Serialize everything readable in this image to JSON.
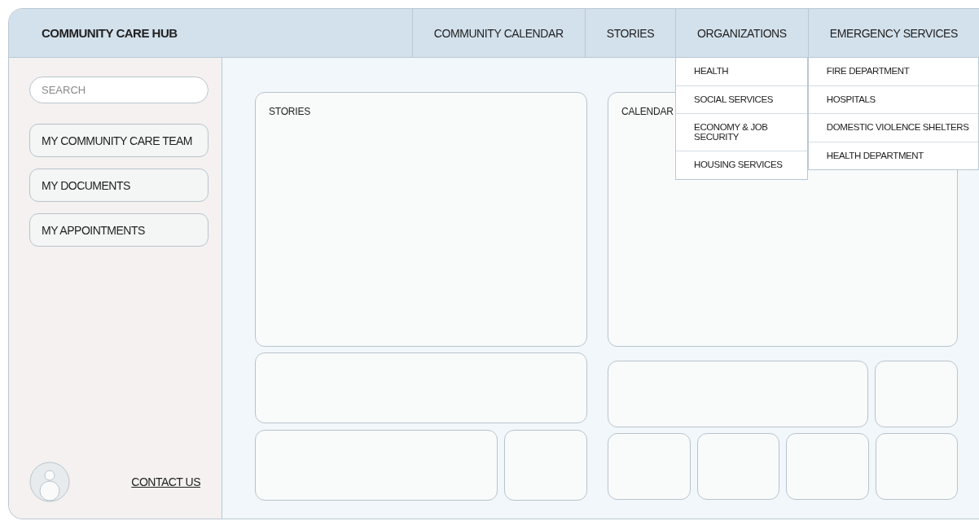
{
  "header": {
    "title": "COMMUNITY CARE HUB"
  },
  "nav": [
    {
      "label": "COMMUNITY CALENDAR"
    },
    {
      "label": "STORIES"
    },
    {
      "label": "ORGANIZATIONS",
      "menu": [
        "HEALTH",
        "SOCIAL SERVICES",
        "ECONOMY & JOB SECURITY",
        "HOUSING SERVICES"
      ]
    },
    {
      "label": "EMERGENCY SERVICES",
      "menu": [
        "FIRE DEPARTMENT",
        "HOSPITALS",
        "DOMESTIC VIOLENCE SHELTERS",
        "HEALTH DEPARTMENT"
      ]
    }
  ],
  "sidebar": {
    "search": {
      "placeholder": "SEARCH"
    },
    "items": [
      "MY COMMUNITY CARE TEAM",
      "MY DOCUMENTS",
      "MY APPOINTMENTS"
    ],
    "contact_link": "CONTACT US"
  },
  "main": {
    "stories": {
      "title": "STORIES"
    },
    "calendar": {
      "title": "CALENDAR"
    }
  }
}
